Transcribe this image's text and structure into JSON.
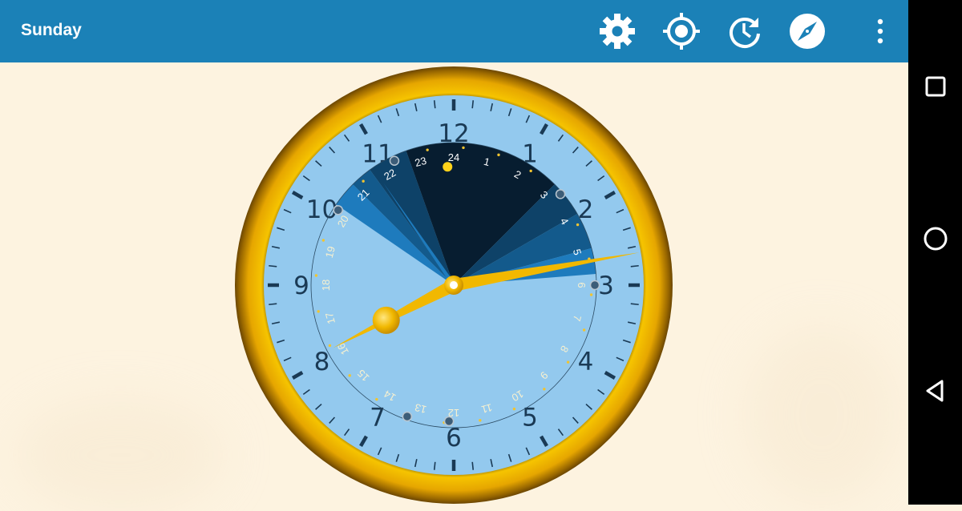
{
  "app": {
    "title": "Sunday"
  },
  "toolbar": {
    "actions": [
      {
        "icon": "gear-icon",
        "label": "Settings"
      },
      {
        "icon": "crosshair-icon",
        "label": "My location"
      },
      {
        "icon": "refresh-clock-icon",
        "label": "Refresh"
      },
      {
        "icon": "compass-icon",
        "label": "Compass"
      },
      {
        "icon": "more-vert-icon",
        "label": "More options"
      }
    ]
  },
  "clock": {
    "hour_numerals": [
      "12",
      "1",
      "2",
      "3",
      "4",
      "5",
      "6",
      "7",
      "8",
      "9",
      "10",
      "11"
    ],
    "day_hours": [
      "24",
      "1",
      "2",
      "3",
      "4",
      "5",
      "6",
      "7",
      "8",
      "9",
      "10",
      "11",
      "12",
      "13",
      "14",
      "15",
      "16",
      "17",
      "18",
      "19",
      "20",
      "21",
      "22",
      "23"
    ],
    "time": {
      "hour": 7,
      "minute": 11
    },
    "colors": {
      "bezel": "#e8a800",
      "dial": "#93c9ee",
      "hands": "#f1b800",
      "night": "#071d30",
      "twilight_dark": "#0e4268",
      "twilight_mid": "#135a8c",
      "twilight_light": "#1e7bbd"
    }
  },
  "navigation": {
    "buttons": [
      {
        "icon": "square-recents-icon",
        "label": "Recents"
      },
      {
        "icon": "circle-home-icon",
        "label": "Home"
      },
      {
        "icon": "triangle-back-icon",
        "label": "Back"
      }
    ]
  }
}
